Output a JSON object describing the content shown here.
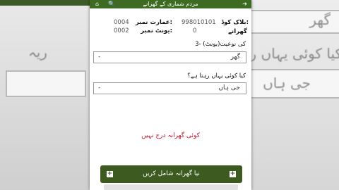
{
  "app": {
    "title": "مردم شماری کے گھرانے"
  },
  "info": {
    "block_label": "بلاک کوڈ:",
    "block_value": "998010101",
    "households_label": "گھرانے",
    "households_value": "0",
    "building_label": "عمارت نمبر:",
    "building_value": "0004",
    "unit_label": "یونٹ نمبر:",
    "unit_value": "0002"
  },
  "q3": {
    "label": "3- (یونٹ)کی نوعیت",
    "value": "گھر",
    "dash": "-"
  },
  "q4": {
    "label": "کیا کوئی یہاں رہتا ہے؟",
    "value": "جی ہاں",
    "dash": "-"
  },
  "empty_message": "کوئی گھرانہ درج نہیں",
  "add_button": {
    "label": "نیا گھرانہ شامل کریں",
    "icon": "+"
  },
  "icons": {
    "home": "⌂",
    "search": "🔍",
    "back": "➔"
  },
  "background": {
    "left_text": "ریہ",
    "right_top": "گھر",
    "right_mid": "کیا کوئی یہاں رہتا",
    "right_bottom": "جی ہاں"
  },
  "colors": {
    "topbar": "#3d6b21",
    "button": "#3d5a20",
    "error_text": "#c8102e"
  }
}
